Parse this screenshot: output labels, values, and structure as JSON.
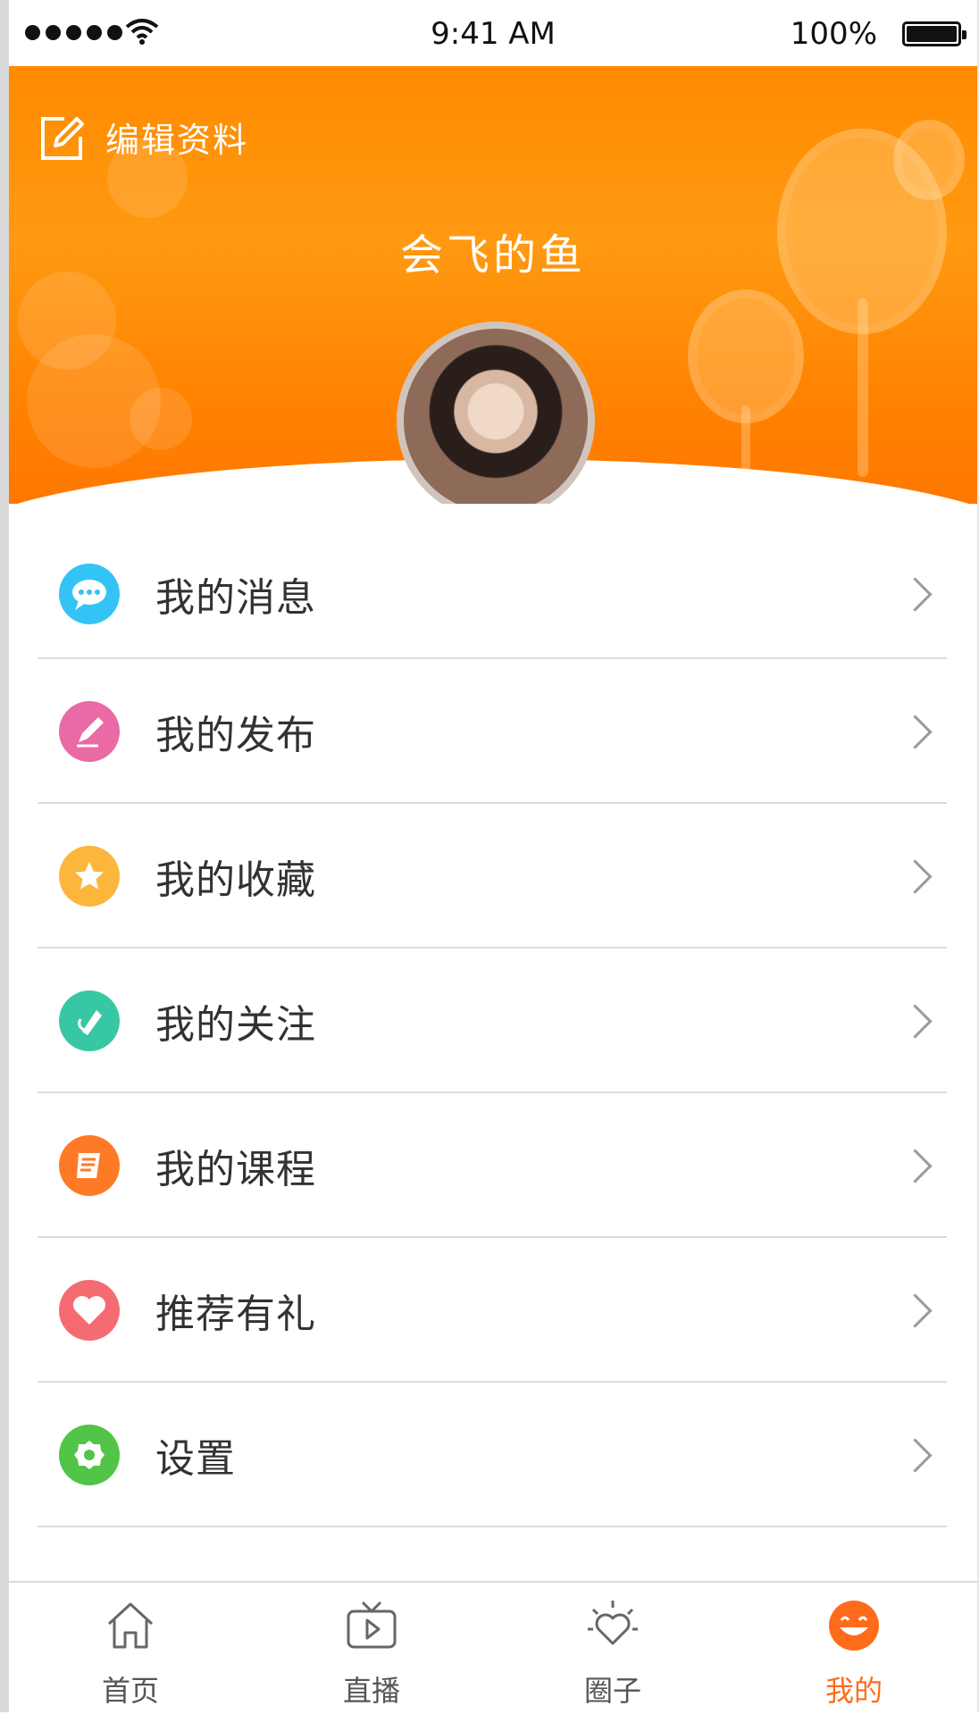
{
  "status_bar": {
    "time": "9:41 AM",
    "battery": "100%"
  },
  "header": {
    "edit_label": "编辑资料",
    "username": "会飞的鱼"
  },
  "menu": {
    "items": [
      {
        "label": "我的消息",
        "icon": "message-icon",
        "color": "#34c3f5"
      },
      {
        "label": "我的发布",
        "icon": "publish-icon",
        "color": "#e96aa5"
      },
      {
        "label": "我的收藏",
        "icon": "star-icon",
        "color": "#fbb63b"
      },
      {
        "label": "我的关注",
        "icon": "follow-icon",
        "color": "#38c7a4"
      },
      {
        "label": "我的课程",
        "icon": "course-icon",
        "color": "#ff7a26"
      },
      {
        "label": "推荐有礼",
        "icon": "heart-icon",
        "color": "#f56b72"
      },
      {
        "label": "设置",
        "icon": "settings-icon",
        "color": "#52c447"
      }
    ]
  },
  "tabbar": {
    "tabs": [
      {
        "label": "首页",
        "icon": "home-icon"
      },
      {
        "label": "直播",
        "icon": "tv-icon"
      },
      {
        "label": "圈子",
        "icon": "circle-heart-icon"
      },
      {
        "label": "我的",
        "icon": "smile-icon",
        "active": true
      }
    ]
  },
  "colors": {
    "accent": "#ff8a00",
    "divider": "#dcdcdc",
    "text": "#323232",
    "active_tab": "#ff6b1a"
  }
}
